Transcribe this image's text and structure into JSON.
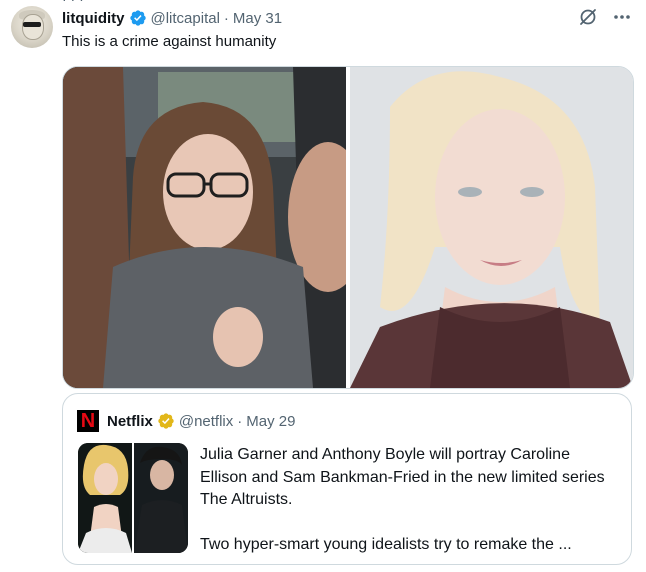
{
  "tweet": {
    "top_clip_text": "· · ·",
    "author_name": "litquidity",
    "author_handle": "@litcapital",
    "separator": "·",
    "date": "May 31",
    "text": "This is a crime against humanity"
  },
  "icons": {
    "verified": "verified-badge-icon",
    "grok": "grok-icon",
    "more": "more-options-icon",
    "netflix_logo": "netflix-logo",
    "gold_badge": "gold-verified-badge-icon"
  },
  "colors": {
    "verified_blue": "#1d9bf0",
    "gold": "#e2b719",
    "netflix_red": "#e50914",
    "secondary_text": "#536471",
    "border": "#cfd9de"
  },
  "quoted_tweet": {
    "author_name": "Netflix",
    "author_handle": "@netflix",
    "separator": "·",
    "date": "May 29",
    "logo_letter": "N",
    "text_line_1": "Julia Garner and Anthony Boyle will portray Caroline Ellison and Sam Bankman-Fried in the new limited series The Altruists.",
    "text_line_2": "Two hyper-smart young idealists try to remake the ..."
  }
}
